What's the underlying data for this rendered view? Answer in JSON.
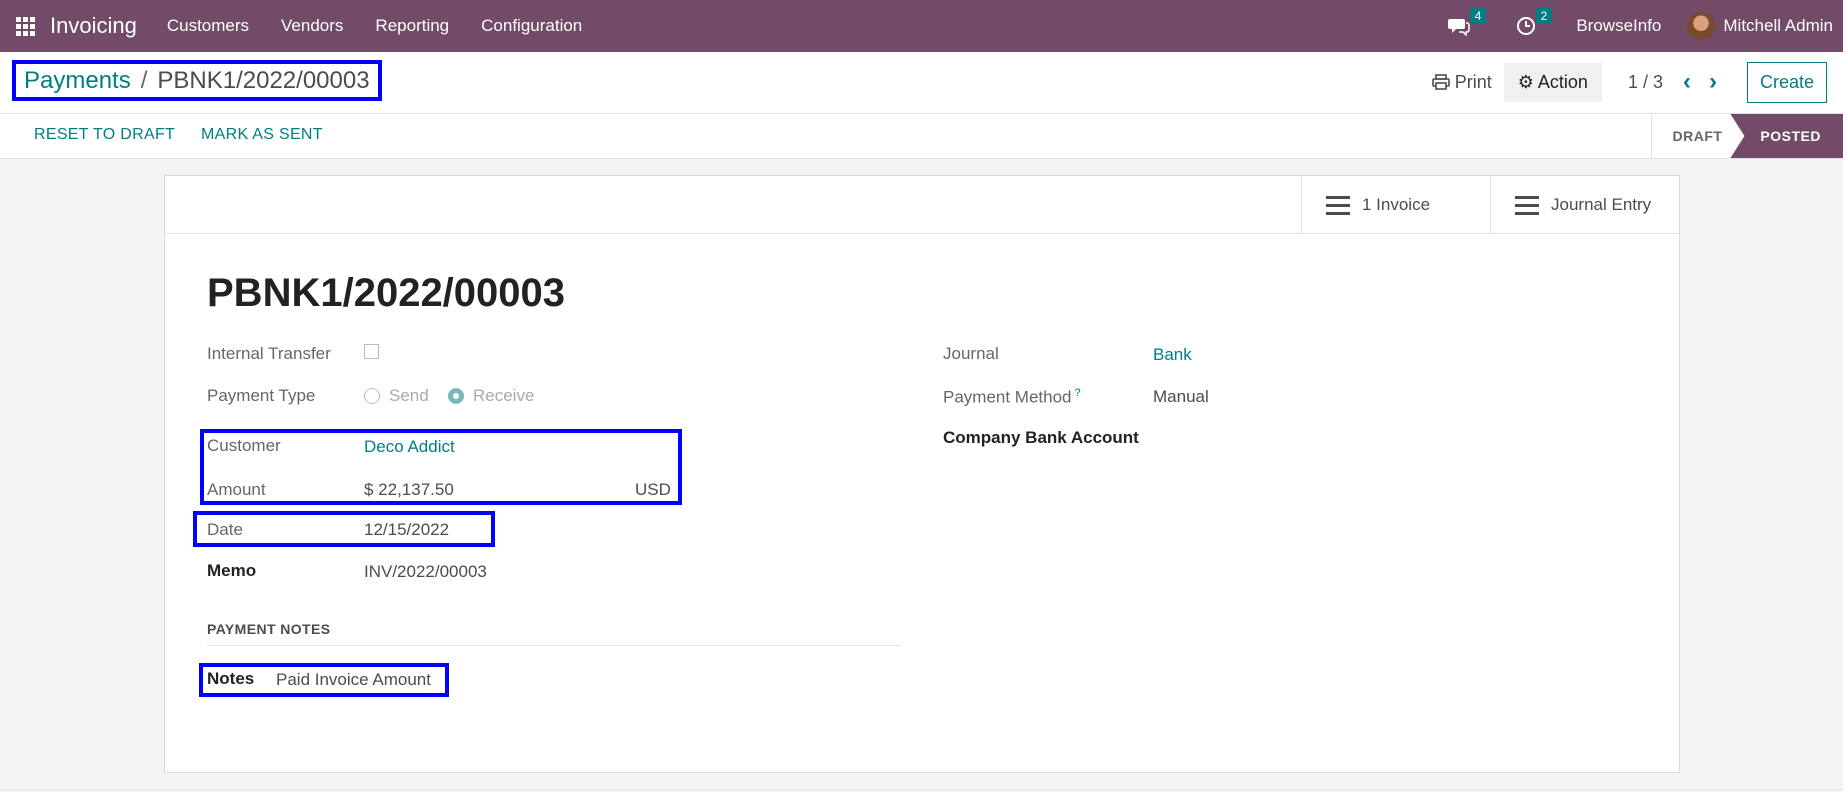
{
  "navbar": {
    "app_name": "Invoicing",
    "menu": [
      "Customers",
      "Vendors",
      "Reporting",
      "Configuration"
    ],
    "messages_badge": "4",
    "activities_badge": "2",
    "company": "BrowseInfo",
    "user": "Mitchell Admin"
  },
  "breadcrumb": {
    "parent": "Payments",
    "separator": "/",
    "current": "PBNK1/2022/00003"
  },
  "control": {
    "print_label": "Print",
    "action_label": "Action",
    "pager": "1 / 3",
    "create_label": "Create"
  },
  "statusbar": {
    "reset_label": "RESET TO DRAFT",
    "mark_sent_label": "MARK AS SENT",
    "stages": [
      "DRAFT",
      "POSTED"
    ],
    "current_stage": "POSTED"
  },
  "smart_buttons": {
    "invoice": "1 Invoice",
    "journal_entry": "Journal Entry"
  },
  "form": {
    "title": "PBNK1/2022/00003",
    "internal_transfer_label": "Internal Transfer",
    "internal_transfer_checked": false,
    "payment_type_label": "Payment Type",
    "payment_type_options": [
      "Send",
      "Receive"
    ],
    "payment_type_value": "Receive",
    "customer_label": "Customer",
    "customer_value": "Deco Addict",
    "amount_label": "Amount",
    "amount_value": "$ 22,137.50",
    "currency": "USD",
    "date_label": "Date",
    "date_value": "12/15/2022",
    "memo_label": "Memo",
    "memo_value": "INV/2022/00003",
    "journal_label": "Journal",
    "journal_value": "Bank",
    "payment_method_label": "Payment Method",
    "payment_method_help": "?",
    "payment_method_value": "Manual",
    "company_bank_label": "Company Bank Account",
    "notes_section": "PAYMENT NOTES",
    "notes_label": "Notes",
    "notes_value": "Paid Invoice Amount"
  },
  "colors": {
    "navbar": "#714b67",
    "link": "#017e84",
    "highlight": "#0000ff"
  }
}
